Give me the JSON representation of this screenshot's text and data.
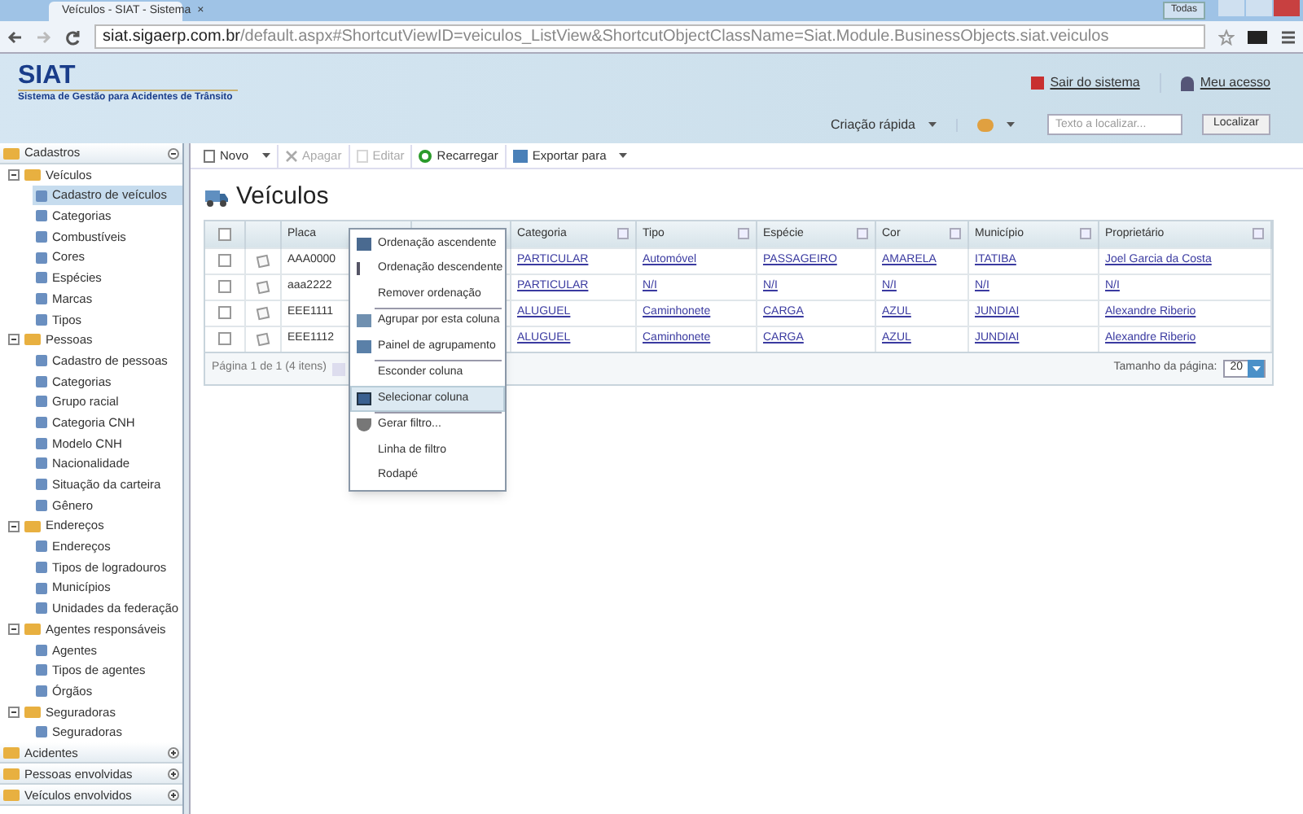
{
  "browser": {
    "tab_title": "Veículos - SIAT - Sistema",
    "tab_close": "×",
    "url_host": "siat.sigaerp.com.br",
    "url_path": "/default.aspx#ShortcutViewID=veiculos_ListView&ShortcutObjectClassName=Siat.Module.BusinessObjects.siat.veiculos",
    "window_badge": "Todas"
  },
  "header": {
    "logo": "SIAT",
    "subtitle": "Sistema de Gestão para Acidentes de Trânsito",
    "links": [
      "Sair do sistema",
      "Meu acesso"
    ],
    "quick_create": "Criação rápida",
    "search": {
      "placeholder": "Texto a localizar..."
    },
    "search_button": "Localizar"
  },
  "sidebar": {
    "sections": [
      {
        "label": "Cadastros",
        "expanded": true,
        "children": [
          {
            "label": "Veículos",
            "expanded": true,
            "children": [
              {
                "label": "Cadastro de veículos",
                "selected": true
              },
              {
                "label": "Categorias",
                "selected": false
              },
              {
                "label": "Combustíveis",
                "selected": false
              },
              {
                "label": "Cores",
                "selected": false
              },
              {
                "label": "Espécies",
                "selected": false
              },
              {
                "label": "Marcas",
                "selected": false
              },
              {
                "label": "Tipos",
                "selected": false
              }
            ]
          },
          {
            "label": "Pessoas",
            "expanded": true,
            "children": [
              {
                "label": "Cadastro de pessoas",
                "selected": false
              },
              {
                "label": "Categorias",
                "selected": false
              },
              {
                "label": "Grupo racial",
                "selected": false
              },
              {
                "label": "Categoria CNH",
                "selected": false
              },
              {
                "label": "Modelo CNH",
                "selected": false
              },
              {
                "label": "Nacionalidade",
                "selected": false
              },
              {
                "label": "Situação da carteira",
                "selected": false
              },
              {
                "label": "Gênero",
                "selected": false
              }
            ]
          },
          {
            "label": "Endereços",
            "expanded": true,
            "children": [
              {
                "label": "Endereços",
                "selected": false
              },
              {
                "label": "Tipos de logradouros",
                "selected": false
              },
              {
                "label": "Municípios",
                "selected": false
              },
              {
                "label": "Unidades da federação",
                "selected": false
              }
            ]
          },
          {
            "label": "Agentes responsáveis",
            "expanded": true,
            "children": [
              {
                "label": "Agentes",
                "selected": false
              },
              {
                "label": "Tipos de agentes",
                "selected": false
              },
              {
                "label": "Órgãos",
                "selected": false
              }
            ]
          },
          {
            "label": "Seguradoras",
            "expanded": true,
            "children": [
              {
                "label": "Seguradoras",
                "selected": false
              }
            ]
          }
        ]
      },
      {
        "label": "Acidentes",
        "expanded": false
      },
      {
        "label": "Pessoas envolvidas",
        "expanded": false
      },
      {
        "label": "Veículos envolvidos",
        "expanded": false
      }
    ]
  },
  "toolbar": [
    {
      "label": "Novo",
      "disabled": false,
      "dropdown": true
    },
    {
      "label": "Apagar",
      "disabled": true,
      "dropdown": false
    },
    {
      "label": "Editar",
      "disabled": true,
      "dropdown": false
    },
    {
      "label": "Recarregar",
      "disabled": false,
      "dropdown": false
    },
    {
      "label": "Exportar para",
      "disabled": false,
      "dropdown": true
    }
  ],
  "page_title": "Veículos",
  "table": {
    "columns": [
      "Placa",
      "",
      "Categoria",
      "Tipo",
      "Espécie",
      "Cor",
      "Município",
      "Proprietário"
    ],
    "select_all_checked": false,
    "row_checked": [
      false,
      false,
      false,
      false
    ],
    "rows": [
      [
        "AAA0000",
        "",
        "PARTICULAR",
        "Automóvel",
        "PASSAGEIRO",
        "AMARELA",
        "ITATIBA",
        "Joel Garcia da Costa"
      ],
      [
        "aaa2222",
        "",
        "PARTICULAR",
        "N/I",
        "N/I",
        "N/I",
        "N/I",
        "N/I"
      ],
      [
        "EEE1111",
        "",
        "ALUGUEL",
        "Caminhonete",
        "CARGA",
        "AZUL",
        "JUNDIAI",
        "Alexandre Riberio"
      ],
      [
        "EEE1112",
        "",
        "ALUGUEL",
        "Caminhonete",
        "CARGA",
        "AZUL",
        "JUNDIAI",
        "Alexandre Riberio"
      ]
    ],
    "pager": "Página 1 de 1 (4 itens)",
    "page_size_label": "Tamanho da página:",
    "page_size": "20"
  },
  "context_menu": [
    {
      "label": "Ordenação ascendente",
      "selected": false,
      "separator": false
    },
    {
      "label": "Ordenação descendente",
      "selected": false,
      "separator": false
    },
    {
      "label": "Remover ordenação",
      "selected": false,
      "separator": true
    },
    {
      "label": "Agrupar por esta coluna",
      "selected": false,
      "separator": false
    },
    {
      "label": "Painel de agrupamento",
      "selected": false,
      "separator": true
    },
    {
      "label": "Esconder coluna",
      "selected": false,
      "separator": false
    },
    {
      "label": "Selecionar coluna",
      "selected": true,
      "separator": true
    },
    {
      "label": "Gerar filtro...",
      "selected": false,
      "separator": false
    },
    {
      "label": "Linha de filtro",
      "selected": false,
      "separator": false
    },
    {
      "label": "Rodapé",
      "selected": false,
      "separator": false
    }
  ]
}
